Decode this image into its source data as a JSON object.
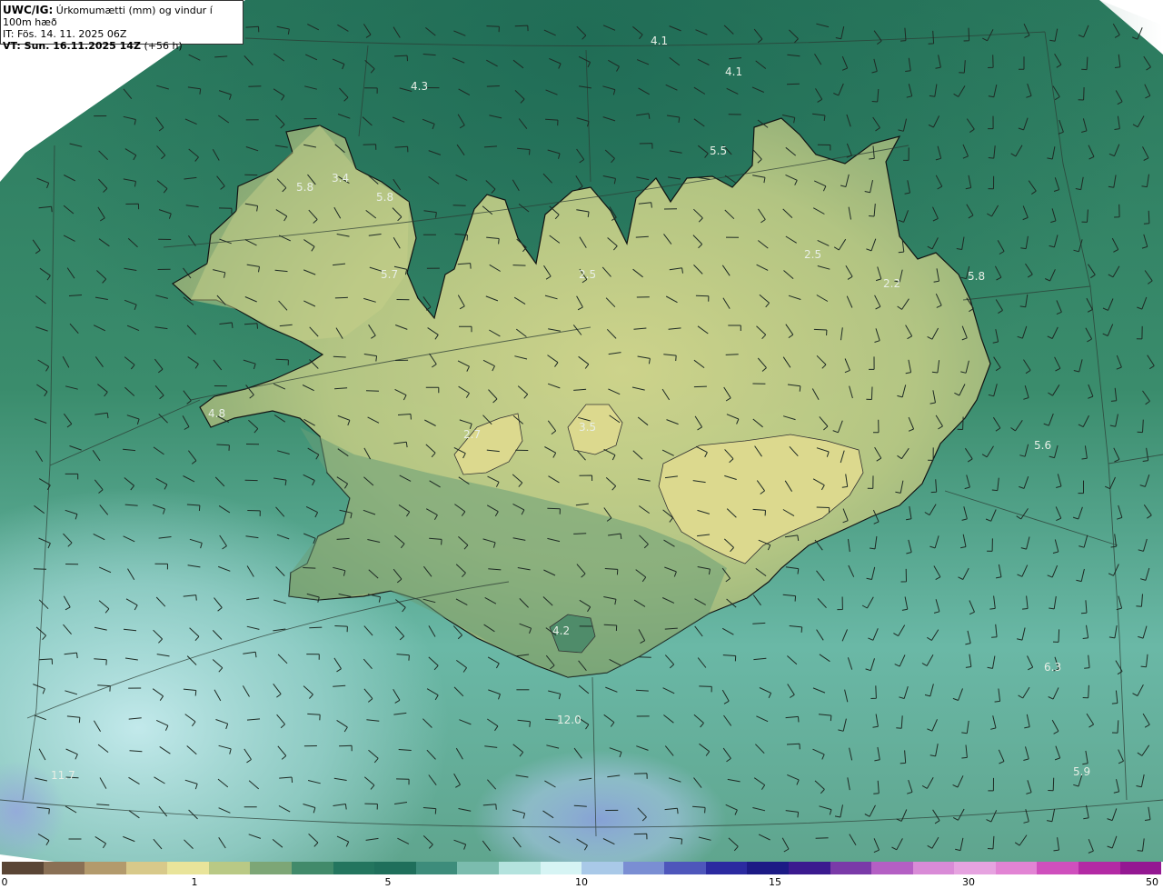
{
  "header": {
    "code": "UWC/IG:",
    "title": "Úrkomumætti (mm) og vindur í 100m hæð",
    "it_label": "IT: Fös. 14. 11. 2025 06Z",
    "vt_label": "VT: Sun. 16.11.2025 14Z",
    "vt_offset": "(+56 h)"
  },
  "map": {
    "value_labels": [
      "4.1",
      "4.1",
      "4.3",
      "5.5",
      "3.4",
      "5.8",
      "5.8",
      "5.7",
      "2.5",
      "2.5",
      "2.2",
      "5.8",
      "4.8",
      "2.7",
      "3.5",
      "5.6",
      "4.2",
      "6.3",
      "12.0",
      "11.7",
      "5.9"
    ]
  },
  "colorbar": {
    "ticks": [
      "0",
      "1",
      "5",
      "10",
      "15",
      "30",
      "50"
    ],
    "colors": [
      "#5a4535",
      "#8a7055",
      "#b39a6c",
      "#d8c98a",
      "#e9e49a",
      "#b9c985",
      "#7da676",
      "#418a6a",
      "#23755e",
      "#1f6f5b",
      "#3d8c7b",
      "#7bbcae",
      "#b4e3de",
      "#d6f4f4",
      "#a9c9e8",
      "#7a8ed3",
      "#4e56bb",
      "#2b2aa0",
      "#1c1a85",
      "#3b1a8f",
      "#7a3aa8",
      "#b45fc4",
      "#d98bd7",
      "#e6a3e0",
      "#e284d4",
      "#cf4fbd",
      "#b32aa4",
      "#941892"
    ]
  }
}
